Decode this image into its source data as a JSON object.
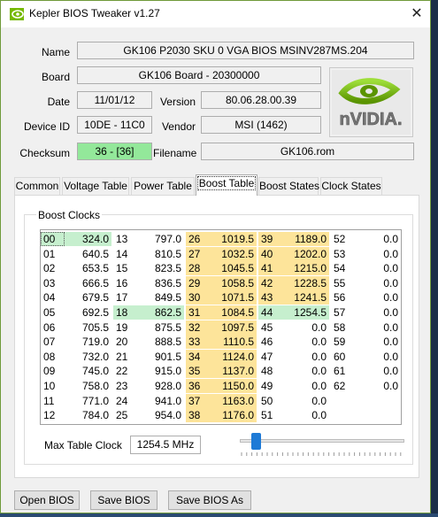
{
  "window": {
    "title": "Kepler BIOS Tweaker v1.27",
    "close_glyph": "✕"
  },
  "info": {
    "name_label": "Name",
    "name_value": "GK106 P2030 SKU 0 VGA BIOS MSINV287MS.204",
    "board_label": "Board",
    "board_value": "GK106 Board - 20300000",
    "date_label": "Date",
    "date_value": "11/01/12",
    "version_label": "Version",
    "version_value": "80.06.28.00.39",
    "deviceid_label": "Device ID",
    "deviceid_value": "10DE - 11C0",
    "vendor_label": "Vendor",
    "vendor_value": "MSI (1462)",
    "checksum_label": "Checksum",
    "checksum_value": "36 - [36]",
    "filename_label": "Filename",
    "filename_value": "GK106.rom",
    "checksum_color": "#93e89a"
  },
  "logo": {
    "text": "nVIDIA.",
    "color": "#76b900",
    "icon": "nvidia-eye-logo"
  },
  "tabs": [
    {
      "label": "Common"
    },
    {
      "label": "Voltage Table"
    },
    {
      "label": "Power Table"
    },
    {
      "label": "Boost Table",
      "active": true
    },
    {
      "label": "Boost States"
    },
    {
      "label": "Clock States"
    }
  ],
  "boost": {
    "group_label": "Boost Clocks",
    "columns": [
      {
        "highlight": "none",
        "rows": [
          [
            "00",
            "324.0"
          ],
          [
            "01",
            "640.5"
          ],
          [
            "02",
            "653.5"
          ],
          [
            "03",
            "666.5"
          ],
          [
            "04",
            "679.5"
          ],
          [
            "05",
            "692.5"
          ],
          [
            "06",
            "705.5"
          ],
          [
            "07",
            "719.0"
          ],
          [
            "08",
            "732.0"
          ],
          [
            "09",
            "745.0"
          ],
          [
            "10",
            "758.0"
          ],
          [
            "11",
            "771.0"
          ],
          [
            "12",
            "784.0"
          ]
        ]
      },
      {
        "highlight": "none",
        "rows": [
          [
            "13",
            "797.0"
          ],
          [
            "14",
            "810.5"
          ],
          [
            "15",
            "823.5"
          ],
          [
            "16",
            "836.5"
          ],
          [
            "17",
            "849.5"
          ],
          [
            "18",
            "862.5"
          ],
          [
            "19",
            "875.5"
          ],
          [
            "20",
            "888.5"
          ],
          [
            "21",
            "901.5"
          ],
          [
            "22",
            "915.0"
          ],
          [
            "23",
            "928.0"
          ],
          [
            "24",
            "941.0"
          ],
          [
            "25",
            "954.0"
          ]
        ]
      },
      {
        "highlight": "yellow",
        "rows": [
          [
            "26",
            "1019.5"
          ],
          [
            "27",
            "1032.5"
          ],
          [
            "28",
            "1045.5"
          ],
          [
            "29",
            "1058.5"
          ],
          [
            "30",
            "1071.5"
          ],
          [
            "31",
            "1084.5"
          ],
          [
            "32",
            "1097.5"
          ],
          [
            "33",
            "1110.5"
          ],
          [
            "34",
            "1124.0"
          ],
          [
            "35",
            "1137.0"
          ],
          [
            "36",
            "1150.0"
          ],
          [
            "37",
            "1163.0"
          ],
          [
            "38",
            "1176.0"
          ]
        ]
      },
      {
        "highlight": "partial",
        "rows": [
          [
            "39",
            "1189.0"
          ],
          [
            "40",
            "1202.0"
          ],
          [
            "41",
            "1215.0"
          ],
          [
            "42",
            "1228.5"
          ],
          [
            "43",
            "1241.5"
          ],
          [
            "44",
            "1254.5"
          ],
          [
            "45",
            "0.0"
          ],
          [
            "46",
            "0.0"
          ],
          [
            "47",
            "0.0"
          ],
          [
            "48",
            "0.0"
          ],
          [
            "49",
            "0.0"
          ],
          [
            "50",
            "0.0"
          ],
          [
            "51",
            "0.0"
          ]
        ]
      },
      {
        "highlight": "none",
        "rows": [
          [
            "52",
            "0.0"
          ],
          [
            "53",
            "0.0"
          ],
          [
            "54",
            "0.0"
          ],
          [
            "55",
            "0.0"
          ],
          [
            "56",
            "0.0"
          ],
          [
            "57",
            "0.0"
          ],
          [
            "58",
            "0.0"
          ],
          [
            "59",
            "0.0"
          ],
          [
            "60",
            "0.0"
          ],
          [
            "61",
            "0.0"
          ],
          [
            "62",
            "0.0"
          ],
          [
            "",
            ""
          ],
          [
            "",
            ""
          ]
        ]
      }
    ],
    "green_cells": [
      [
        0,
        0
      ],
      [
        1,
        5
      ],
      [
        3,
        5
      ]
    ],
    "max_label": "Max Table Clock",
    "max_value": "1254.5 MHz",
    "slider_fraction": 0.06,
    "colors": {
      "yellow": "#fde49a",
      "green": "#c6efce"
    }
  },
  "buttons": {
    "open": "Open BIOS",
    "save": "Save BIOS",
    "save_as": "Save BIOS As"
  }
}
